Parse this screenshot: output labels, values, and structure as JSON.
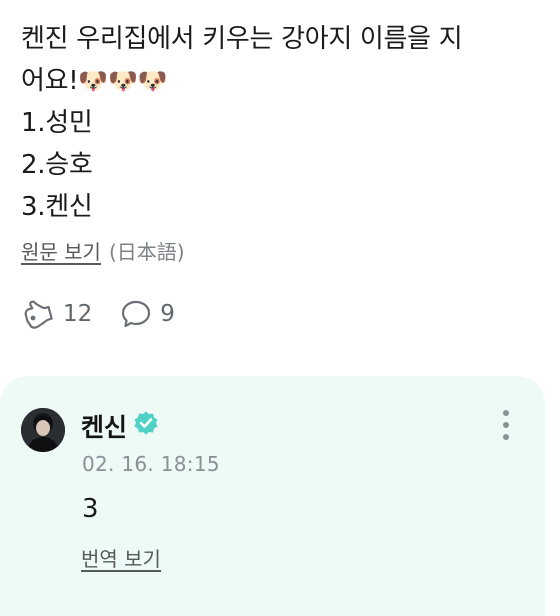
{
  "post": {
    "lines": [
      "켄진 우리집에서 키우는 강아지 이름을 지",
      "어요!",
      "1.성민",
      "2.승호",
      "3.켄신"
    ],
    "emoji": "🐶🐶🐶",
    "translate_link": "원문 보기",
    "language_tag": "(日本語)",
    "likes": "12",
    "comments": "9"
  },
  "comment": {
    "author": "켄신",
    "timestamp": "02. 16. 18:15",
    "text": "3",
    "translate_link": "번역 보기"
  },
  "colors": {
    "comment_bg": "#eefaf6",
    "verified": "#4fd1c5"
  }
}
